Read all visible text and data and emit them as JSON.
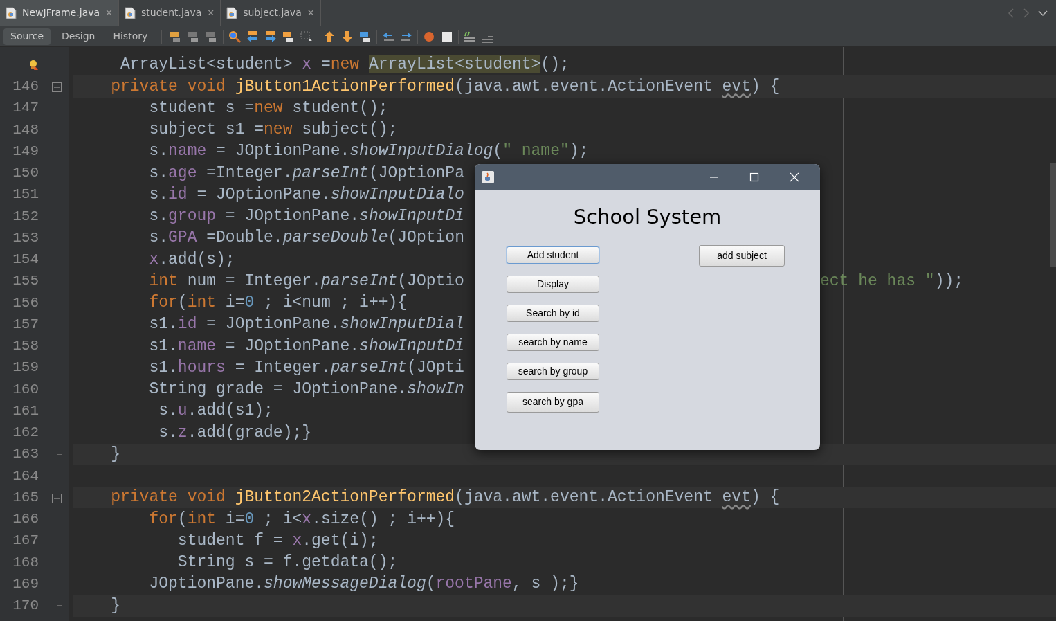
{
  "file_tabs": [
    {
      "label": "NewJFrame.java",
      "selected": true,
      "close": "✕"
    },
    {
      "label": "student.java",
      "selected": false,
      "close": "✕"
    },
    {
      "label": "subject.java",
      "selected": false,
      "close": "✕"
    }
  ],
  "view_tabs": [
    {
      "label": "Source",
      "selected": true
    },
    {
      "label": "Design",
      "selected": false
    },
    {
      "label": "History",
      "selected": false
    }
  ],
  "editor": {
    "lines": [
      {
        "hint": true,
        "highlighted": false,
        "kind": "plain",
        "tokens": [
          {
            "kind": "plain",
            "text": "     ArrayList<student> "
          },
          {
            "kind": "field",
            "text": "x"
          },
          {
            "kind": "plain",
            "text": " ="
          },
          {
            "kind": "keyword",
            "text": "new "
          },
          {
            "kind": "match",
            "text": "ArrayList<student>"
          },
          {
            "kind": "plain",
            "text": "();"
          }
        ]
      },
      {
        "number": "146",
        "highlighted": true,
        "kind": "fold-start",
        "tokens": [
          {
            "kind": "keyword",
            "text": "    private void "
          },
          {
            "kind": "decl",
            "text": "jButton1ActionPerformed"
          },
          {
            "kind": "plain",
            "text": "(java.awt.event.ActionEvent "
          },
          {
            "kind": "param",
            "text": "evt"
          },
          {
            "kind": "plain",
            "text": ") {"
          }
        ]
      },
      {
        "number": "147",
        "highlighted": false,
        "kind": "fold-body",
        "tokens": [
          {
            "kind": "plain",
            "text": "        student s ="
          },
          {
            "kind": "keyword",
            "text": "new"
          },
          {
            "kind": "plain",
            "text": " student();"
          }
        ]
      },
      {
        "number": "148",
        "highlighted": false,
        "kind": "fold-body",
        "tokens": [
          {
            "kind": "plain",
            "text": "        subject s1 ="
          },
          {
            "kind": "keyword",
            "text": "new"
          },
          {
            "kind": "plain",
            "text": " subject();"
          }
        ]
      },
      {
        "number": "149",
        "highlighted": false,
        "kind": "fold-body",
        "tokens": [
          {
            "kind": "plain",
            "text": "        s."
          },
          {
            "kind": "field",
            "text": "name"
          },
          {
            "kind": "plain",
            "text": " = JOptionPane."
          },
          {
            "kind": "method",
            "text": "showInputDialog"
          },
          {
            "kind": "plain",
            "text": "("
          },
          {
            "kind": "string",
            "text": "\" name\""
          },
          {
            "kind": "plain",
            "text": ");"
          }
        ]
      },
      {
        "number": "150",
        "highlighted": false,
        "kind": "fold-body",
        "tokens": [
          {
            "kind": "plain",
            "text": "        s."
          },
          {
            "kind": "field",
            "text": "age"
          },
          {
            "kind": "plain",
            "text": " =Integer."
          },
          {
            "kind": "method",
            "text": "parseInt"
          },
          {
            "kind": "plain",
            "text": "(JOptionPa"
          }
        ]
      },
      {
        "number": "151",
        "highlighted": false,
        "kind": "fold-body",
        "tokens": [
          {
            "kind": "plain",
            "text": "        s."
          },
          {
            "kind": "field",
            "text": "id"
          },
          {
            "kind": "plain",
            "text": " = JOptionPane."
          },
          {
            "kind": "method",
            "text": "showInputDialo"
          }
        ]
      },
      {
        "number": "152",
        "highlighted": false,
        "kind": "fold-body",
        "tokens": [
          {
            "kind": "plain",
            "text": "        s."
          },
          {
            "kind": "field",
            "text": "group"
          },
          {
            "kind": "plain",
            "text": " = JOptionPane."
          },
          {
            "kind": "method",
            "text": "showInputDi"
          }
        ]
      },
      {
        "number": "153",
        "highlighted": false,
        "kind": "fold-body",
        "tokens": [
          {
            "kind": "plain",
            "text": "        s."
          },
          {
            "kind": "field",
            "text": "GPA"
          },
          {
            "kind": "plain",
            "text": " =Double."
          },
          {
            "kind": "method",
            "text": "parseDouble"
          },
          {
            "kind": "plain",
            "text": "(JOption"
          }
        ]
      },
      {
        "number": "154",
        "highlighted": false,
        "kind": "fold-body",
        "tokens": [
          {
            "kind": "field",
            "text": "        x"
          },
          {
            "kind": "plain",
            "text": ".add(s);"
          }
        ]
      },
      {
        "number": "155",
        "highlighted": false,
        "kind": "fold-body",
        "tokens": [
          {
            "kind": "keyword",
            "text": "        int"
          },
          {
            "kind": "plain",
            "text": " num = Integer."
          },
          {
            "kind": "method",
            "text": "parseInt"
          },
          {
            "kind": "plain",
            "text": "(JOptio"
          }
        ],
        "tail": [
          {
            "kind": "string",
            "text": "ect he has \""
          },
          {
            "kind": "plain",
            "text": "));"
          }
        ]
      },
      {
        "number": "156",
        "highlighted": false,
        "kind": "fold-body",
        "tokens": [
          {
            "kind": "keyword",
            "text": "        for"
          },
          {
            "kind": "plain",
            "text": "("
          },
          {
            "kind": "keyword",
            "text": "int"
          },
          {
            "kind": "plain",
            "text": " i="
          },
          {
            "kind": "number",
            "text": "0"
          },
          {
            "kind": "plain",
            "text": " ; i<num ; i++){"
          }
        ]
      },
      {
        "number": "157",
        "highlighted": false,
        "kind": "fold-body",
        "tokens": [
          {
            "kind": "plain",
            "text": "        s1."
          },
          {
            "kind": "field",
            "text": "id"
          },
          {
            "kind": "plain",
            "text": " = JOptionPane."
          },
          {
            "kind": "method",
            "text": "showInputDial"
          }
        ]
      },
      {
        "number": "158",
        "highlighted": false,
        "kind": "fold-body",
        "tokens": [
          {
            "kind": "plain",
            "text": "        s1."
          },
          {
            "kind": "field",
            "text": "name"
          },
          {
            "kind": "plain",
            "text": " = JOptionPane."
          },
          {
            "kind": "method",
            "text": "showInputDi"
          }
        ]
      },
      {
        "number": "159",
        "highlighted": false,
        "kind": "fold-body",
        "tokens": [
          {
            "kind": "plain",
            "text": "        s1."
          },
          {
            "kind": "field",
            "text": "hours"
          },
          {
            "kind": "plain",
            "text": " = Integer."
          },
          {
            "kind": "method",
            "text": "parseInt"
          },
          {
            "kind": "plain",
            "text": "(JOpti"
          }
        ]
      },
      {
        "number": "160",
        "highlighted": false,
        "kind": "fold-body",
        "tokens": [
          {
            "kind": "plain",
            "text": "        String grade = JOptionPane."
          },
          {
            "kind": "method",
            "text": "showIn"
          }
        ]
      },
      {
        "number": "161",
        "highlighted": false,
        "kind": "fold-body",
        "tokens": [
          {
            "kind": "plain",
            "text": "         s."
          },
          {
            "kind": "field",
            "text": "u"
          },
          {
            "kind": "plain",
            "text": ".add(s1);"
          }
        ]
      },
      {
        "number": "162",
        "highlighted": false,
        "kind": "fold-body",
        "tokens": [
          {
            "kind": "plain",
            "text": "         s."
          },
          {
            "kind": "field",
            "text": "z"
          },
          {
            "kind": "plain",
            "text": ".add(grade);}"
          }
        ]
      },
      {
        "number": "163",
        "highlighted": true,
        "kind": "fold-end",
        "tokens": [
          {
            "kind": "plain",
            "text": "    }"
          }
        ]
      },
      {
        "number": "164",
        "highlighted": false,
        "kind": "plain"
      },
      {
        "number": "165",
        "highlighted": true,
        "kind": "fold-start",
        "tokens": [
          {
            "kind": "keyword",
            "text": "    private void "
          },
          {
            "kind": "decl",
            "text": "jButton2ActionPerformed"
          },
          {
            "kind": "plain",
            "text": "(java.awt.event.ActionEvent "
          },
          {
            "kind": "param",
            "text": "evt"
          },
          {
            "kind": "plain",
            "text": ") {"
          }
        ]
      },
      {
        "number": "166",
        "highlighted": false,
        "kind": "fold-body",
        "tokens": [
          {
            "kind": "keyword",
            "text": "        for"
          },
          {
            "kind": "plain",
            "text": "("
          },
          {
            "kind": "keyword",
            "text": "int"
          },
          {
            "kind": "plain",
            "text": " i="
          },
          {
            "kind": "number",
            "text": "0"
          },
          {
            "kind": "plain",
            "text": " ; i<"
          },
          {
            "kind": "field",
            "text": "x"
          },
          {
            "kind": "plain",
            "text": ".size() ; i++){"
          }
        ]
      },
      {
        "number": "167",
        "highlighted": false,
        "kind": "fold-body",
        "tokens": [
          {
            "kind": "plain",
            "text": "           student f = "
          },
          {
            "kind": "field",
            "text": "x"
          },
          {
            "kind": "plain",
            "text": ".get(i);"
          }
        ]
      },
      {
        "number": "168",
        "highlighted": false,
        "kind": "fold-body",
        "tokens": [
          {
            "kind": "plain",
            "text": "           String s = f.getdata();"
          }
        ]
      },
      {
        "number": "169",
        "highlighted": false,
        "kind": "fold-body",
        "tokens": [
          {
            "kind": "plain",
            "text": "        JOptionPane."
          },
          {
            "kind": "method",
            "text": "showMessageDialog"
          },
          {
            "kind": "plain",
            "text": "("
          },
          {
            "kind": "field",
            "text": "rootPane"
          },
          {
            "kind": "plain",
            "text": ", s );}"
          }
        ]
      },
      {
        "number": "170",
        "highlighted": true,
        "kind": "fold-end",
        "tokens": [
          {
            "kind": "plain",
            "text": "    }"
          }
        ]
      }
    ]
  },
  "dialog": {
    "title": "School System",
    "left_buttons": [
      {
        "label": "Add student",
        "focused": true
      },
      {
        "label": "Display",
        "focused": false
      },
      {
        "label": "Search by id",
        "focused": false
      },
      {
        "label": "search by name",
        "focused": false
      },
      {
        "label": "search by group",
        "focused": false
      },
      {
        "label": "search by gpa",
        "focused": false
      }
    ],
    "right_buttons": [
      {
        "label": "add subject",
        "focused": false
      }
    ]
  }
}
